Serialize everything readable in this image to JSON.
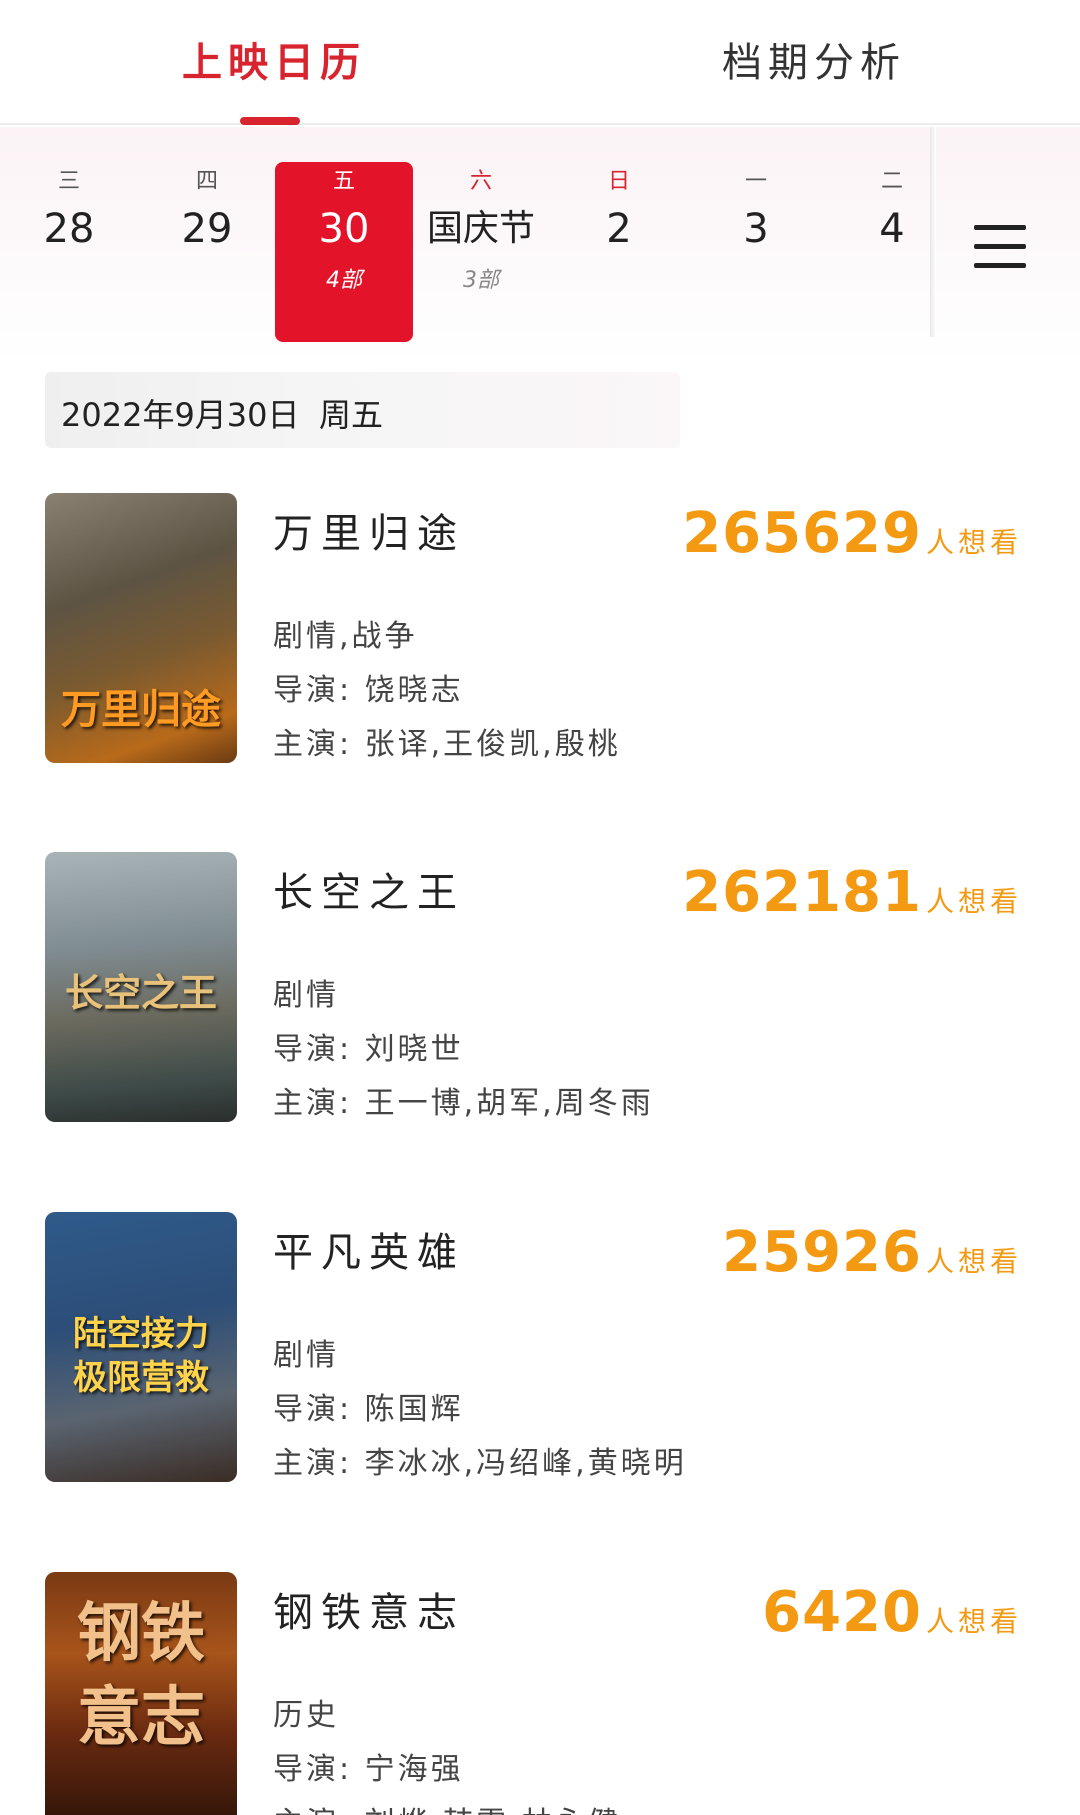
{
  "tabs": [
    {
      "label": "上映日历",
      "active": true
    },
    {
      "label": "档期分析",
      "active": false
    }
  ],
  "days": [
    {
      "weekday": "三",
      "date": "28",
      "count": "",
      "selected": false,
      "weekend": false
    },
    {
      "weekday": "四",
      "date": "29",
      "count": "",
      "selected": false,
      "weekend": false
    },
    {
      "weekday": "五",
      "date": "30",
      "count": "4部",
      "selected": true,
      "weekend": false
    },
    {
      "weekday": "六",
      "date": "国庆节",
      "count": "3部",
      "selected": false,
      "weekend": true
    },
    {
      "weekday": "日",
      "date": "2",
      "count": "",
      "selected": false,
      "weekend": true
    },
    {
      "weekday": "一",
      "date": "3",
      "count": "",
      "selected": false,
      "weekend": false
    },
    {
      "weekday": "二",
      "date": "4",
      "count": "",
      "selected": false,
      "weekend": false
    }
  ],
  "menu_icon": "hamburger-menu-icon",
  "selected_date": {
    "date": "2022年9月30日",
    "weekday": "周五"
  },
  "movies": [
    {
      "title": "万里归途",
      "want_count": "265629",
      "want_unit": "人想看",
      "genre": "剧情,战争",
      "director": "导演: 饶晓志",
      "cast": "主演: 张译,王俊凯,殷桃",
      "poster_text": "万里归途"
    },
    {
      "title": "长空之王",
      "want_count": "262181",
      "want_unit": "人想看",
      "genre": "剧情",
      "director": "导演: 刘晓世",
      "cast": "主演: 王一博,胡军,周冬雨",
      "poster_text": "长空之王"
    },
    {
      "title": "平凡英雄",
      "want_count": "25926",
      "want_unit": "人想看",
      "genre": "剧情",
      "director": "导演: 陈国辉",
      "cast": "主演: 李冰冰,冯绍峰,黄晓明",
      "poster_text": "陆空接力 极限营救"
    },
    {
      "title": "钢铁意志",
      "want_count": "6420",
      "want_unit": "人想看",
      "genre": "历史",
      "director": "导演: 宁海强",
      "cast": "主演: 刘烨,韩雪,林永健",
      "poster_text": "钢铁意志"
    }
  ],
  "colors": {
    "accent": "#e3142a",
    "want": "#f39a12"
  }
}
